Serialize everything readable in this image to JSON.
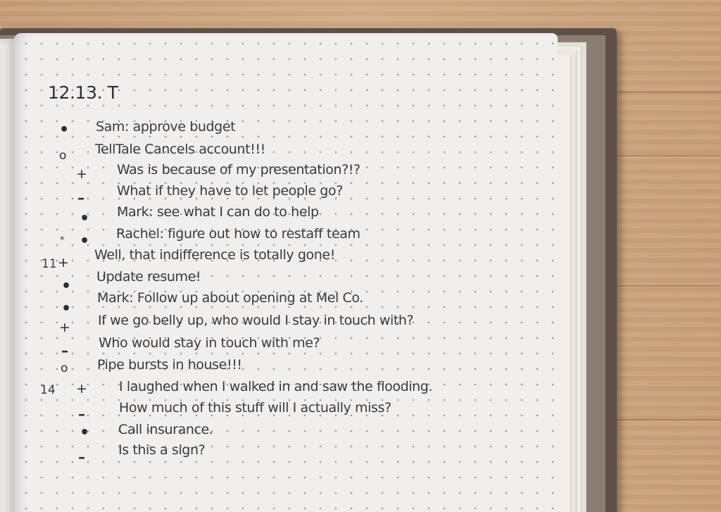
{
  "journal": {
    "date": "12.13. T",
    "entries": [
      {
        "signifier": "",
        "bullet": "•",
        "text": "Sam: approve budget"
      },
      {
        "signifier": "",
        "bullet": "o",
        "text": "TellTale Cancels account!!!"
      },
      {
        "signifier": "",
        "bullet": "+",
        "text": "Was is because of my presentation?!?"
      },
      {
        "signifier": "",
        "bullet": "–",
        "text": "What if they have to let people go?"
      },
      {
        "signifier": "",
        "bullet": "•",
        "text": "Mark: see what I can do to help"
      },
      {
        "signifier": "*",
        "bullet": "•",
        "text": "Rachel: figure out how to restaff team"
      },
      {
        "signifier": "11",
        "bullet": "+",
        "text": "Well, that indifference is totally gone!"
      },
      {
        "signifier": "",
        "bullet": "•",
        "text": "Update resume!"
      },
      {
        "signifier": "",
        "bullet": "•",
        "text": "Mark: Follow up about opening at Mel Co."
      },
      {
        "signifier": "",
        "bullet": "+",
        "text": "If we go belly up, who would I stay in touch with?"
      },
      {
        "signifier": "",
        "bullet": "–",
        "text": "Who would stay in touch with me?"
      },
      {
        "signifier": "",
        "bullet": "o",
        "text": "Pipe bursts in house!!!"
      },
      {
        "signifier": "14",
        "bullet": "+",
        "text": "I laughed when I walked in and saw the flooding."
      },
      {
        "signifier": "",
        "bullet": "–",
        "text": "How much of this stuff will I actually miss?"
      },
      {
        "signifier": "",
        "bullet": "•",
        "text": "Call insurance."
      },
      {
        "signifier": "",
        "bullet": "–",
        "text": "Is this a sign?"
      }
    ]
  },
  "colors": {
    "ink": "#3a3a3c",
    "paper": "#f0efee",
    "cover": "#5e5048",
    "table_wood": "#c9a37e"
  }
}
